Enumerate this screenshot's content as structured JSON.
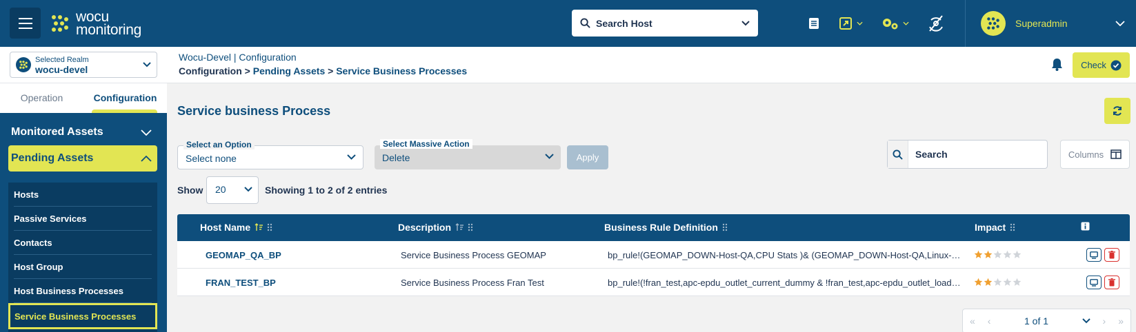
{
  "topbar": {
    "logo_line1": "wocu",
    "logo_line2": "monitoring",
    "host_search_placeholder": "Search Host",
    "user_name": "Superadmin"
  },
  "realm": {
    "caption": "Selected Realm",
    "value": "wocu-devel"
  },
  "sidebar": {
    "tabs": [
      "Operation",
      "Configuration"
    ],
    "active_tab": "Configuration",
    "sections": [
      {
        "label": "Monitored Assets",
        "open": false
      },
      {
        "label": "Pending Assets",
        "open": true
      }
    ],
    "items": [
      {
        "label": "Hosts"
      },
      {
        "label": "Passive Services"
      },
      {
        "label": "Contacts"
      },
      {
        "label": "Host Group"
      },
      {
        "label": "Host Business Processes"
      },
      {
        "label": "Service Business Processes"
      }
    ],
    "active_item": "Service Business Processes"
  },
  "header": {
    "context": "Wocu-Devel | Configuration",
    "crumb_root": "Configuration",
    "crumb_sep": ">",
    "crumb_mid": "Pending Assets",
    "crumb_leaf": "Service Business Processes",
    "check_label": "Check"
  },
  "main": {
    "title": "Service business Process",
    "option_caption": "Select an Option",
    "option_value": "Select none",
    "mass_caption": "Select Massive Action",
    "mass_value": "Delete",
    "apply_label": "Apply",
    "search_placeholder": "Search",
    "columns_label": "Columns",
    "show_label": "Show",
    "page_size": "20",
    "showing_text": "Showing 1 to 2 of 2 entries"
  },
  "table": {
    "columns": [
      "Host Name",
      "Description",
      "Business Rule Definition",
      "Impact"
    ],
    "rows": [
      {
        "host": "GEOMAP_QA_BP",
        "description": "Service Business Process GEOMAP",
        "rule": "bp_rule!(GEOMAP_DOWN-Host-QA,CPU Stats )& (GEOMAP_DOWN-Host-QA,Linux-…",
        "impact": 2
      },
      {
        "host": "FRAN_TEST_BP",
        "description": "Service Business Process Fran Test",
        "rule": "bp_rule!(!fran_test,apc-epdu_outlet_current_dummy & !fran_test,apc-epdu_outlet_load…",
        "impact": 2
      }
    ]
  },
  "pager": {
    "page_text": "1 of 1"
  },
  "colors": {
    "brand": "#0e4e7c",
    "accent": "#e2e553",
    "danger": "#d9302e",
    "star": "#f0a030"
  },
  "icons": [
    "menu-icon",
    "search-icon",
    "chevron-down-icon",
    "book-icon",
    "external-link-icon",
    "gears-icon",
    "no-signal-icon",
    "bell-icon",
    "check-circle-icon",
    "refresh-icon",
    "columns-icon",
    "sort-icon",
    "drag-icon",
    "info-icon",
    "monitor-icon",
    "trash-icon",
    "star-icon",
    "first-page-icon",
    "prev-page-icon",
    "next-page-icon",
    "last-page-icon"
  ]
}
